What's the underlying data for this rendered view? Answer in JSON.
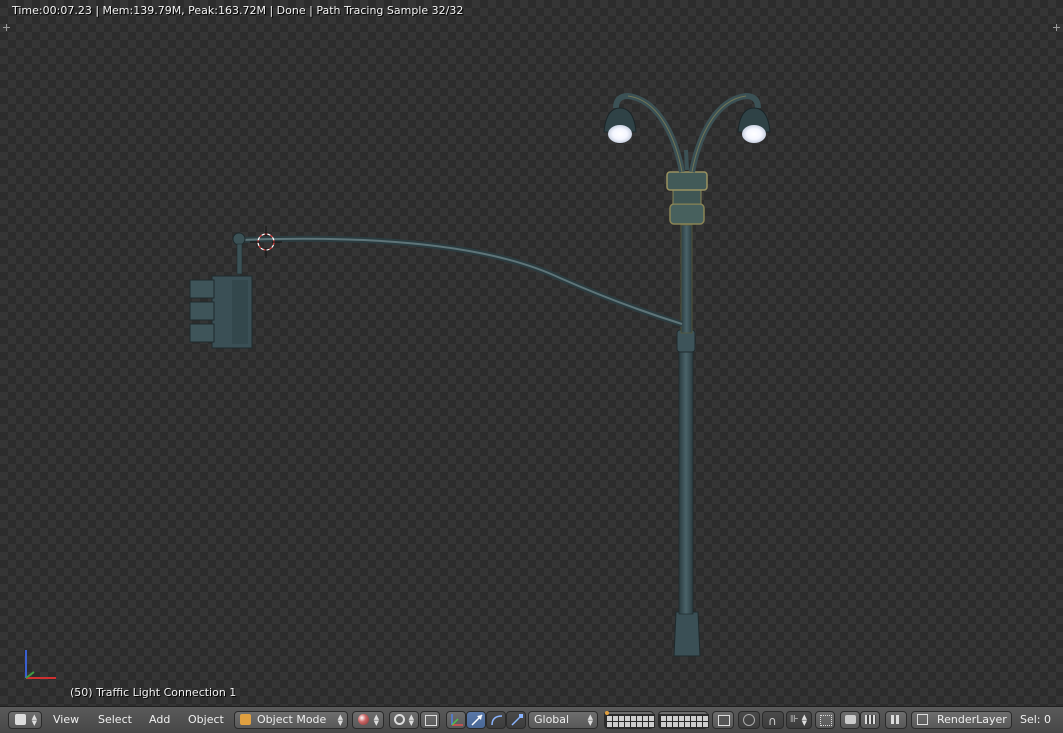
{
  "viewport": {
    "render_info": "Time:00:07.23 | Mem:139.79M, Peak:163.72M | Done | Path Tracing Sample 32/32",
    "object_label": "(50) Traffic Light Connection 1"
  },
  "header": {
    "menu": [
      "View",
      "Select",
      "Add",
      "Object"
    ],
    "mode": "Object Mode",
    "orientation": "Global",
    "render_layer": "RenderLayer",
    "selection": "Sel: 0"
  },
  "colors": {
    "viewport_bg": "#2c2c2c",
    "header_bg": "#4f4f4f",
    "active_blue": "#5a78a8",
    "pole": "#3c5258",
    "lamp_glow": "#ffffff"
  },
  "icons": [
    "editor-type-cube-icon",
    "object-cube-icon",
    "shading-sphere-icon",
    "pivot-icon",
    "manipulator-axes-icon",
    "translate-arrow-icon",
    "rotate-arc-icon",
    "scale-icon",
    "layers-grid-icon",
    "proportional-edit-icon",
    "snap-magnet-icon",
    "render-camera-icon",
    "render-clapper-icon",
    "render-layer-icon"
  ]
}
